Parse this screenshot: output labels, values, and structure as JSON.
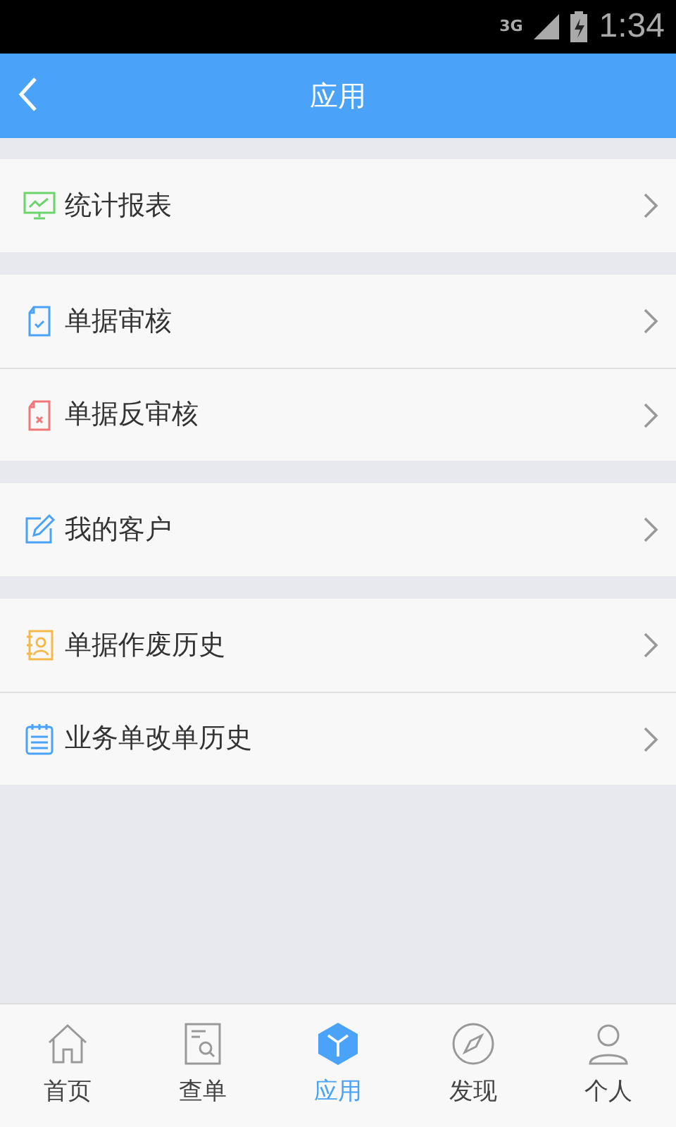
{
  "status_bar": {
    "network": "3G",
    "time": "1:34"
  },
  "header": {
    "title": "应用"
  },
  "groups": [
    {
      "items": [
        {
          "kind": "chart",
          "label": "统计报表"
        }
      ]
    },
    {
      "items": [
        {
          "kind": "doc-check",
          "label": "单据审核"
        },
        {
          "kind": "doc-cross",
          "label": "单据反审核"
        }
      ]
    },
    {
      "items": [
        {
          "kind": "edit",
          "label": "我的客户"
        }
      ]
    },
    {
      "items": [
        {
          "kind": "contact",
          "label": "单据作废历史"
        },
        {
          "kind": "notepad",
          "label": "业务单改单历史"
        }
      ]
    }
  ],
  "tabs": [
    {
      "kind": "home",
      "label": "首页",
      "selected": false
    },
    {
      "kind": "search-doc",
      "label": "查单",
      "selected": false
    },
    {
      "kind": "cube",
      "label": "应用",
      "selected": true
    },
    {
      "kind": "compass",
      "label": "发现",
      "selected": false
    },
    {
      "kind": "person",
      "label": "个人",
      "selected": false
    }
  ]
}
